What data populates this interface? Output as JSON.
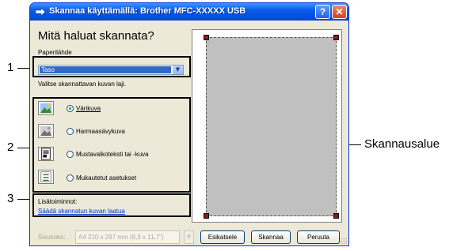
{
  "window": {
    "title": "Skannaa käyttämällä: Brother MFC-",
    "title_model": "XXXXX",
    "title_suffix": " USB",
    "help_glyph": "?",
    "close_glyph": "✕"
  },
  "dialog": {
    "heading": "Mitä haluat skannata?",
    "source_label": "Paperilähde",
    "source_value": "Taso",
    "picture_type_label": "Valitse skannattavan kuvan laji.",
    "options": [
      {
        "label": "Värikuva",
        "selected": true,
        "icon": "color-picture-icon"
      },
      {
        "label": "Harmaasävykuva",
        "selected": false,
        "icon": "grayscale-picture-icon"
      },
      {
        "label": "Mustavalkoteksti tai -kuva",
        "selected": false,
        "icon": "bw-text-picture-icon"
      },
      {
        "label": "Mukautetut asetukset",
        "selected": false,
        "icon": "custom-settings-icon"
      }
    ],
    "extras_label": "Lisätoiminnot:",
    "extras_link": "Säädä skannatun kuvan laatua",
    "page_size_label": "Sivukoko:",
    "page_size_value": "A4 210 x 297 mm (8,3 x 11,7\")",
    "buttons": {
      "preview": "Esikatsele",
      "scan": "Skannaa",
      "cancel": "Peruuta"
    }
  },
  "callouts": {
    "one": "1",
    "two": "2",
    "three": "3",
    "scan_area": "Skannausalue"
  },
  "colors": {
    "titlebar": "#0a5ce9",
    "highlight_border": "#000000",
    "scan_area": "#c0c0c0",
    "handles": "#8b1a1a",
    "link": "#0033cc"
  }
}
